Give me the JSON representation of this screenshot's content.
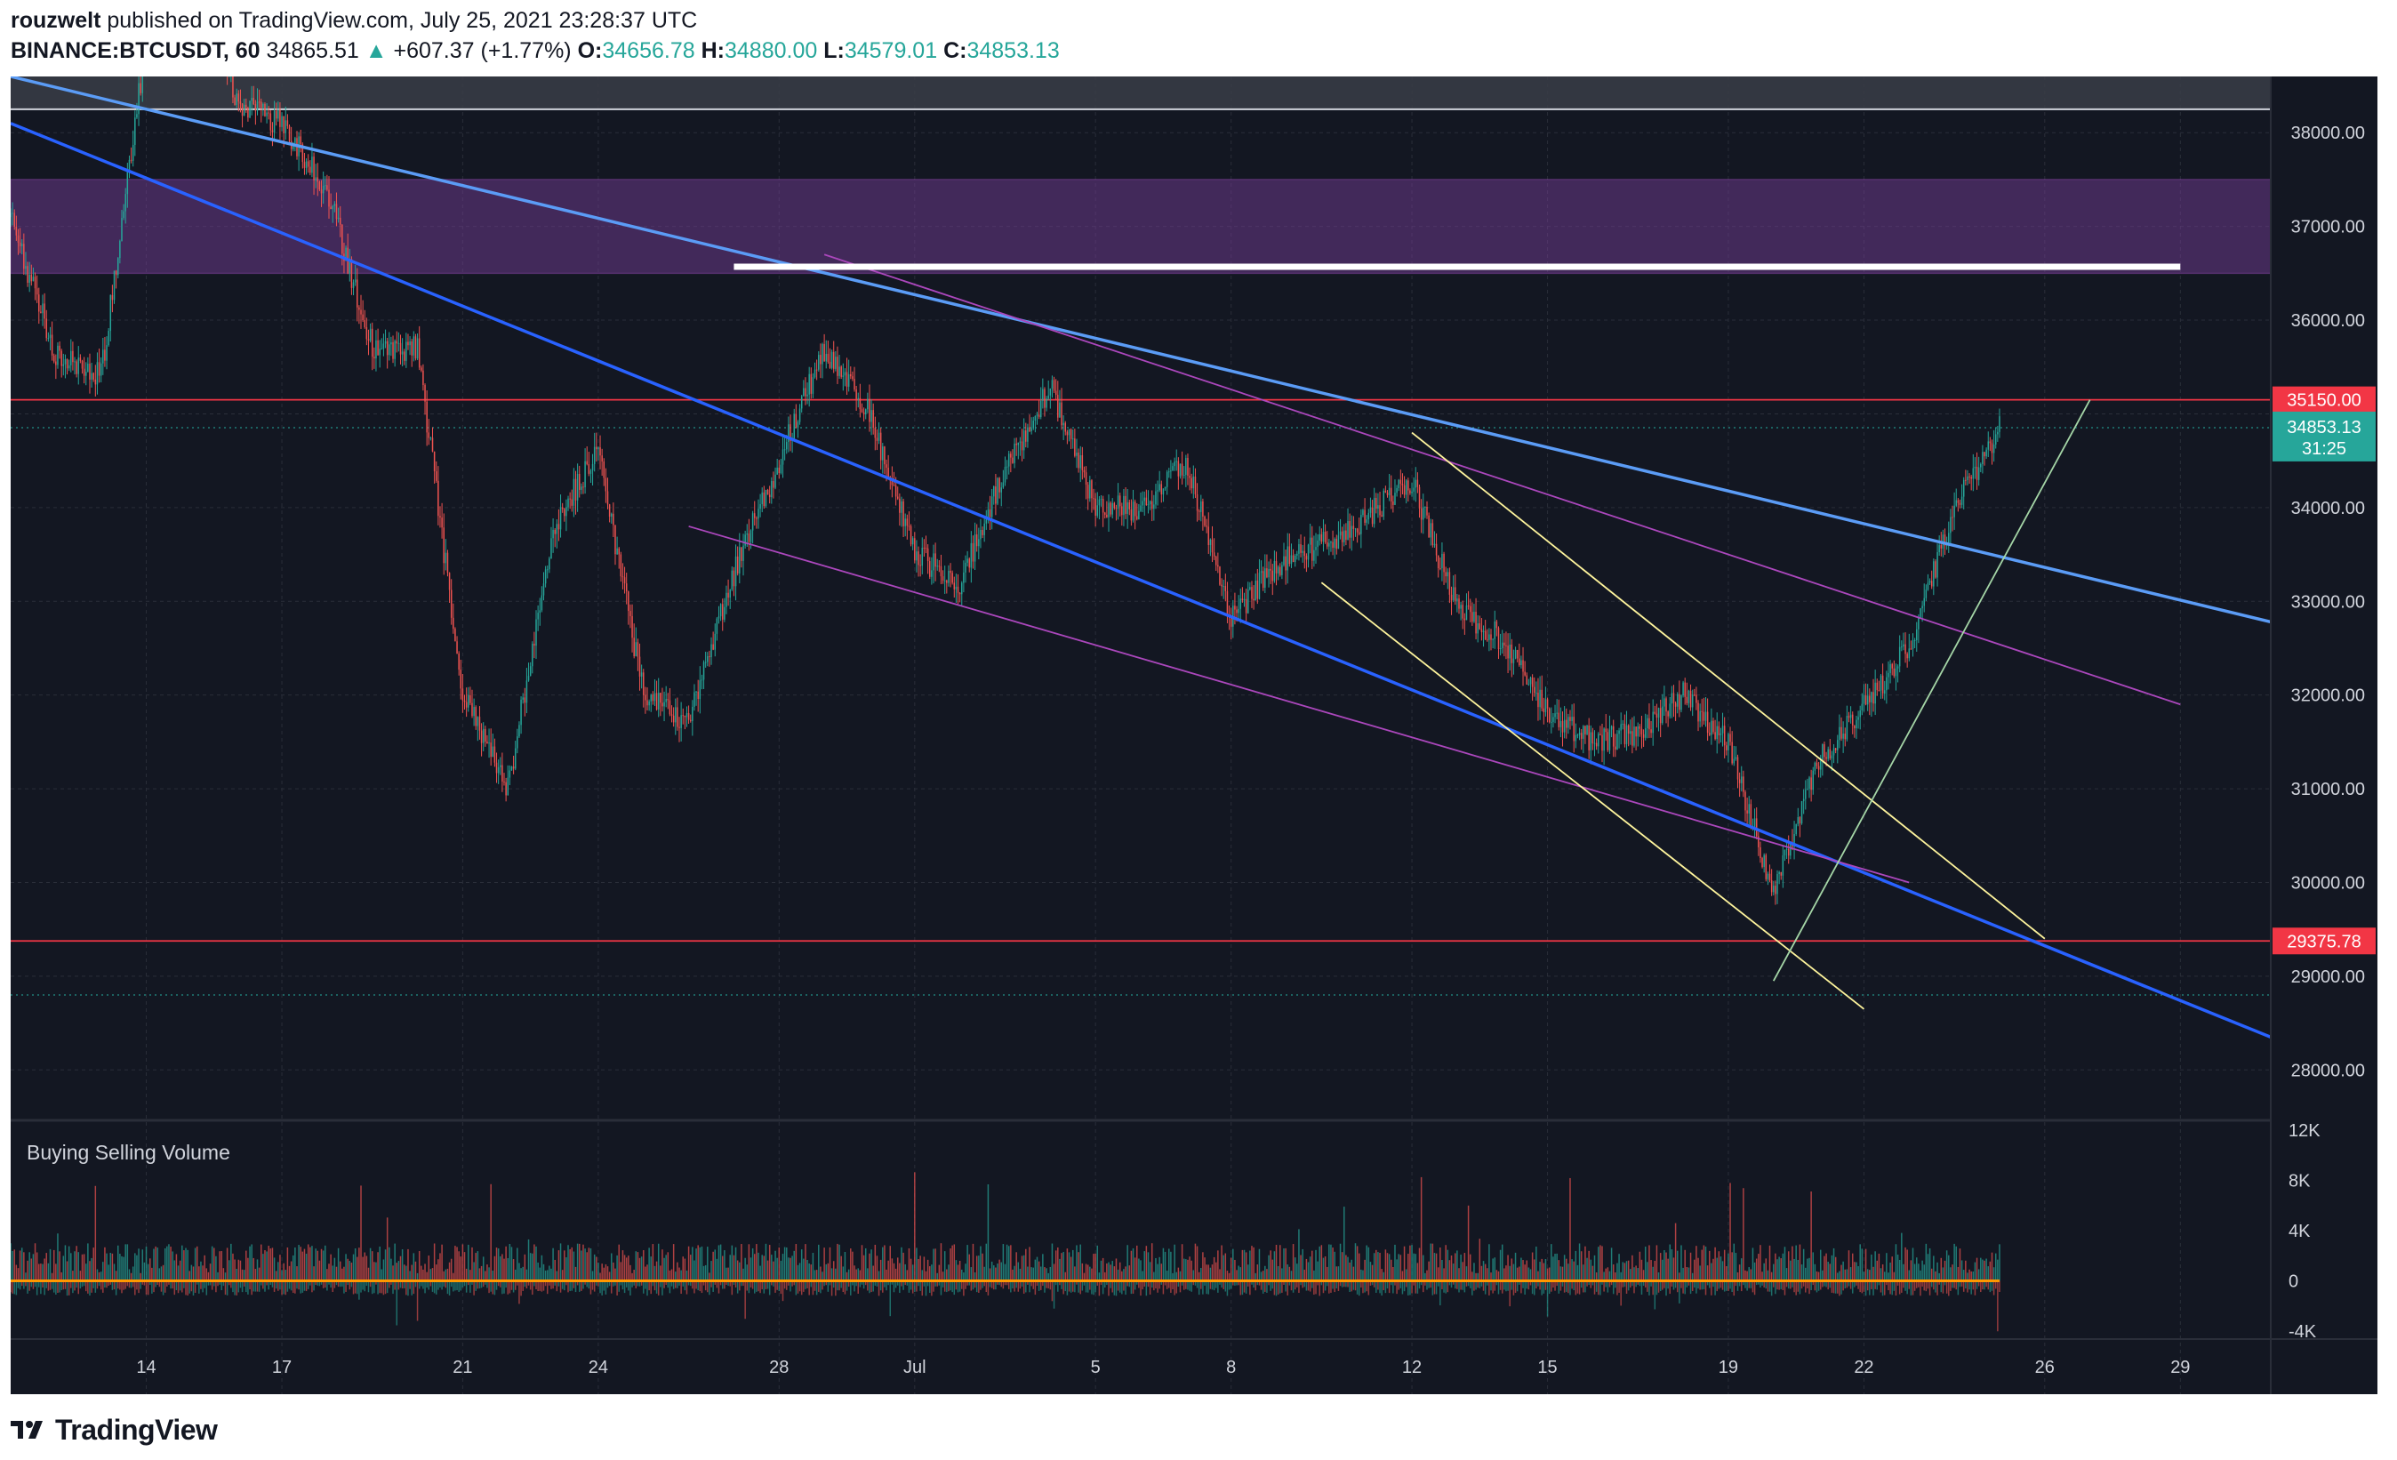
{
  "header": {
    "author": "rouzwelt",
    "published_text": " published on TradingView.com, July 25, 2021 23:28:37 UTC",
    "symbol": "BINANCE:BTCUSDT, 60",
    "last": "34865.51",
    "change": "+607.37 (+1.77%)",
    "o_label": "O:",
    "o_value": "34656.78",
    "h_label": "H:",
    "h_value": "34880.00",
    "l_label": "L:",
    "l_value": "34579.01",
    "c_label": "C:",
    "c_value": "34853.13",
    "up_arrow": "▲"
  },
  "footer": {
    "logo_text": "TradingView",
    "logo_icon": "tradingview-logo-icon"
  },
  "colors": {
    "background": "#131722",
    "grid": "#2a2e39",
    "up": "#26a69a",
    "down": "#ef5350",
    "resistance_zone": "#7b3f9e",
    "horizontal_red": "#f23645",
    "trend_blue_light": "#5b9cf6",
    "trend_blue": "#2962ff",
    "trend_purple": "#ab47bc",
    "trend_yellow": "#fff59d",
    "trend_green": "#a5d6a7",
    "white_line": "#ffffff",
    "axis_text": "#d1d4dc"
  },
  "chart_data": {
    "type": "candlestick",
    "timeframe": "60",
    "y_ticks": [
      "38000.00",
      "37000.00",
      "36000.00",
      "35000.00",
      "34000.00",
      "33000.00",
      "32000.00",
      "31000.00",
      "30000.00",
      "29000.00",
      "28000.00"
    ],
    "ylim": [
      27500,
      38600
    ],
    "x_ticks": [
      "14",
      "17",
      "21",
      "24",
      "28",
      "Jul",
      "5",
      "8",
      "12",
      "15",
      "19",
      "22",
      "26",
      "29"
    ],
    "x_tick_dates": [
      "2021-06-14",
      "2021-06-17",
      "2021-06-21",
      "2021-06-24",
      "2021-06-28",
      "2021-07-01",
      "2021-07-05",
      "2021-07-08",
      "2021-07-12",
      "2021-07-15",
      "2021-07-19",
      "2021-07-22",
      "2021-07-26",
      "2021-07-29"
    ],
    "xlim": [
      "2021-06-11",
      "2021-07-31"
    ],
    "price_path": [
      {
        "date": "2021-06-11",
        "price": 37100
      },
      {
        "date": "2021-06-12",
        "price": 35600
      },
      {
        "date": "2021-06-13",
        "price": 35400
      },
      {
        "date": "2021-06-14",
        "price": 39000
      },
      {
        "date": "2021-06-15",
        "price": 40200
      },
      {
        "date": "2021-06-16",
        "price": 38300
      },
      {
        "date": "2021-06-17",
        "price": 38100
      },
      {
        "date": "2021-06-18",
        "price": 37400
      },
      {
        "date": "2021-06-19",
        "price": 35700
      },
      {
        "date": "2021-06-20",
        "price": 35700
      },
      {
        "date": "2021-06-21",
        "price": 32000
      },
      {
        "date": "2021-06-22",
        "price": 31000
      },
      {
        "date": "2021-06-23",
        "price": 33800
      },
      {
        "date": "2021-06-24",
        "price": 34600
      },
      {
        "date": "2021-06-25",
        "price": 32000
      },
      {
        "date": "2021-06-26",
        "price": 31700
      },
      {
        "date": "2021-06-27",
        "price": 33300
      },
      {
        "date": "2021-06-28",
        "price": 34500
      },
      {
        "date": "2021-06-29",
        "price": 35700
      },
      {
        "date": "2021-06-30",
        "price": 35000
      },
      {
        "date": "2021-07-01",
        "price": 33500
      },
      {
        "date": "2021-07-02",
        "price": 33200
      },
      {
        "date": "2021-07-03",
        "price": 34400
      },
      {
        "date": "2021-07-04",
        "price": 35300
      },
      {
        "date": "2021-07-05",
        "price": 34000
      },
      {
        "date": "2021-07-06",
        "price": 34000
      },
      {
        "date": "2021-07-07",
        "price": 34500
      },
      {
        "date": "2021-07-08",
        "price": 32800
      },
      {
        "date": "2021-07-09",
        "price": 33400
      },
      {
        "date": "2021-07-10",
        "price": 33600
      },
      {
        "date": "2021-07-11",
        "price": 33900
      },
      {
        "date": "2021-07-12",
        "price": 34300
      },
      {
        "date": "2021-07-13",
        "price": 32900
      },
      {
        "date": "2021-07-14",
        "price": 32600
      },
      {
        "date": "2021-07-15",
        "price": 31800
      },
      {
        "date": "2021-07-16",
        "price": 31500
      },
      {
        "date": "2021-07-17",
        "price": 31600
      },
      {
        "date": "2021-07-18",
        "price": 32000
      },
      {
        "date": "2021-07-19",
        "price": 31500
      },
      {
        "date": "2021-07-20",
        "price": 29900
      },
      {
        "date": "2021-07-21",
        "price": 31300
      },
      {
        "date": "2021-07-22",
        "price": 31900
      },
      {
        "date": "2021-07-23",
        "price": 32500
      },
      {
        "date": "2021-07-24",
        "price": 34000
      },
      {
        "date": "2021-07-25",
        "price": 34853.13
      }
    ],
    "resistance_zone": [
      36500,
      37500
    ],
    "horizontal_levels": [
      {
        "price": 35150,
        "label": "35150.00",
        "color": "#f23645"
      },
      {
        "price": 29375.78,
        "label": "29375.78",
        "color": "#f23645"
      }
    ],
    "top_band_price": 38250,
    "dotted_levels": [
      34853.13,
      28800
    ],
    "current_price_label": "34853.13",
    "countdown_label": "31:25",
    "white_level": {
      "price": 36570,
      "from": "2021-06-27",
      "to": "2021-07-29"
    },
    "trend_lines": [
      {
        "color": "#5b9cf6",
        "from": {
          "date": "2021-06-11",
          "price": 38600
        },
        "to": {
          "date": "2021-07-31",
          "price": 32780
        }
      },
      {
        "color": "#2962ff",
        "from": {
          "date": "2021-06-11",
          "price": 38100
        },
        "to": {
          "date": "2021-07-31",
          "price": 28350
        }
      },
      {
        "color": "#ab47bc",
        "from": {
          "date": "2021-06-29",
          "price": 36700
        },
        "to": {
          "date": "2021-07-29",
          "price": 31900
        }
      },
      {
        "color": "#ab47bc",
        "from": {
          "date": "2021-06-26",
          "price": 33800
        },
        "to": {
          "date": "2021-07-23",
          "price": 30000
        }
      },
      {
        "color": "#fff59d",
        "from": {
          "date": "2021-07-12",
          "price": 34800
        },
        "to": {
          "date": "2021-07-26",
          "price": 29400
        }
      },
      {
        "color": "#fff59d",
        "from": {
          "date": "2021-07-10",
          "price": 33200
        },
        "to": {
          "date": "2021-07-22",
          "price": 28650
        }
      },
      {
        "color": "#a5d6a7",
        "from": {
          "date": "2021-07-20",
          "price": 28950
        },
        "to": {
          "date": "2021-07-27",
          "price": 35150
        }
      }
    ],
    "volume": {
      "title": "Buying Selling Volume",
      "y_ticks": [
        "12K",
        "8K",
        "4K",
        "0",
        "-4K"
      ],
      "ylim": [
        -4500,
        12500
      ]
    }
  }
}
